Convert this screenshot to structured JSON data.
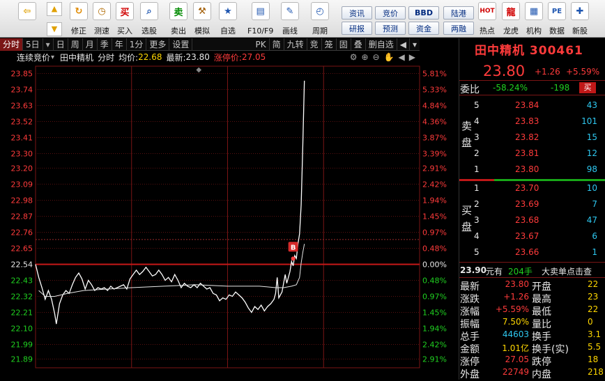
{
  "toolbar": {
    "items": [
      {
        "label": "",
        "icon": "back-arrow-icon"
      },
      {
        "label": "修正",
        "icon": "refresh-icon"
      },
      {
        "label": "测速",
        "icon": "stopwatch-icon"
      },
      {
        "label": "买入",
        "icon": "buy-icon",
        "glyph": "买"
      },
      {
        "label": "选股",
        "icon": "stock-picker-icon"
      },
      {
        "label": "卖出",
        "icon": "sell-icon",
        "glyph": "卖"
      },
      {
        "label": "模拟",
        "icon": "hammer-icon"
      },
      {
        "label": "自选",
        "icon": "watchlist-icon"
      },
      {
        "label": "F10/F9",
        "icon": "f10-icon"
      },
      {
        "label": "画线",
        "icon": "draw-line-icon"
      },
      {
        "label": "周期",
        "icon": "period-icon"
      },
      {
        "label": "热点",
        "icon": "hotspot-icon"
      },
      {
        "label": "龙虎",
        "icon": "dragon-tiger-icon"
      },
      {
        "label": "机构",
        "icon": "institution-icon"
      },
      {
        "label": "数据",
        "icon": "data-icon",
        "glyph": "PE"
      },
      {
        "label": "新股",
        "icon": "new-stock-icon"
      }
    ],
    "small_buttons": [
      "资讯",
      "研报",
      "竞价",
      "预测",
      "BBD",
      "资金",
      "陆港",
      "两融"
    ]
  },
  "tabs": [
    "分时",
    "5日",
    "日",
    "周",
    "月",
    "季",
    "年",
    "1分",
    "更多",
    "设置"
  ],
  "tabs_right": [
    "PK",
    "简",
    "九转",
    "竞",
    "笼",
    "固",
    "叠",
    "删自选"
  ],
  "infobar": {
    "mode": "连续竞价",
    "stock": "田中精机",
    "view": "分时",
    "avg_label": "均价:",
    "avg_value": "22.68",
    "latest_label": "最新:",
    "latest_value": "23.80",
    "limit_label": "涨停价:",
    "limit_value": "27.05"
  },
  "chart_data": {
    "type": "line",
    "prev_close": 22.54,
    "ylim": [
      21.83,
      23.9
    ],
    "yticks": [
      "23.85",
      "23.74",
      "23.63",
      "23.52",
      "23.41",
      "23.30",
      "23.20",
      "23.09",
      "22.98",
      "22.87",
      "22.76",
      "22.65",
      "22.54",
      "22.43",
      "22.32",
      "22.21",
      "22.10",
      "21.99",
      "21.89"
    ],
    "pct_ticks": [
      "5.81%",
      "5.33%",
      "4.84%",
      "4.36%",
      "3.87%",
      "3.39%",
      "2.91%",
      "2.42%",
      "1.94%",
      "1.45%",
      "0.97%",
      "0.48%",
      "0.00%",
      "0.48%",
      "0.97%",
      "1.45%",
      "1.94%",
      "2.42%",
      "2.91%"
    ],
    "xlim": [
      0,
      240
    ],
    "series": [
      {
        "name": "price",
        "color": "#ffffff",
        "points": [
          [
            0,
            22.54
          ],
          [
            2,
            22.45
          ],
          [
            4,
            22.38
          ],
          [
            6,
            22.3
          ],
          [
            8,
            22.36
          ],
          [
            10,
            22.3
          ],
          [
            12,
            22.2
          ],
          [
            13,
            22.13
          ],
          [
            15,
            22.27
          ],
          [
            17,
            22.33
          ],
          [
            19,
            22.36
          ],
          [
            21,
            22.34
          ],
          [
            23,
            22.4
          ],
          [
            25,
            22.45
          ],
          [
            27,
            22.48
          ],
          [
            29,
            22.44
          ],
          [
            31,
            22.37
          ],
          [
            33,
            22.43
          ],
          [
            35,
            22.4
          ],
          [
            37,
            22.36
          ],
          [
            39,
            22.38
          ],
          [
            41,
            22.37
          ],
          [
            43,
            22.38
          ],
          [
            45,
            22.36
          ],
          [
            47,
            22.39
          ],
          [
            49,
            22.37
          ],
          [
            51,
            22.38
          ],
          [
            53,
            22.39
          ],
          [
            55,
            22.4
          ],
          [
            57,
            22.37
          ],
          [
            59,
            22.44
          ],
          [
            61,
            22.47
          ],
          [
            63,
            22.5
          ],
          [
            65,
            22.47
          ],
          [
            67,
            22.49
          ],
          [
            69,
            22.52
          ],
          [
            71,
            22.49
          ],
          [
            73,
            22.46
          ],
          [
            75,
            22.47
          ],
          [
            77,
            22.5
          ],
          [
            79,
            22.47
          ],
          [
            81,
            22.43
          ],
          [
            83,
            22.45
          ],
          [
            85,
            22.42
          ],
          [
            87,
            22.47
          ],
          [
            89,
            22.43
          ],
          [
            91,
            22.38
          ],
          [
            93,
            22.41
          ],
          [
            95,
            22.39
          ],
          [
            97,
            22.38
          ],
          [
            99,
            22.4
          ],
          [
            101,
            22.38
          ],
          [
            103,
            22.41
          ],
          [
            105,
            22.39
          ],
          [
            107,
            22.37
          ],
          [
            109,
            22.38
          ],
          [
            111,
            22.34
          ],
          [
            113,
            22.33
          ],
          [
            115,
            22.29
          ],
          [
            117,
            22.31
          ],
          [
            119,
            22.3
          ],
          [
            121,
            22.33
          ],
          [
            123,
            22.32
          ],
          [
            125,
            22.35
          ],
          [
            127,
            22.33
          ],
          [
            129,
            22.31
          ],
          [
            131,
            22.28
          ],
          [
            133,
            22.24
          ],
          [
            135,
            22.21
          ],
          [
            137,
            22.25
          ],
          [
            139,
            22.23
          ],
          [
            141,
            22.26
          ],
          [
            143,
            22.22
          ],
          [
            145,
            22.25
          ],
          [
            147,
            22.27
          ],
          [
            149,
            22.3
          ],
          [
            150,
            22.34
          ],
          [
            151,
            22.45
          ],
          [
            152,
            22.31
          ],
          [
            154,
            22.35
          ],
          [
            156,
            22.47
          ],
          [
            157,
            22.41
          ],
          [
            159,
            22.49
          ],
          [
            160,
            22.56
          ],
          [
            161,
            22.53
          ],
          [
            162,
            22.6
          ],
          [
            163,
            22.58
          ],
          [
            164,
            22.68
          ],
          [
            165,
            22.75
          ],
          [
            166,
            22.95
          ],
          [
            167,
            23.35
          ],
          [
            168,
            23.8
          ]
        ]
      },
      {
        "name": "avg",
        "color": "#e8e8e8",
        "points": [
          [
            2,
            22.36
          ],
          [
            6,
            22.32
          ],
          [
            12,
            22.32
          ],
          [
            20,
            22.34
          ],
          [
            30,
            22.36
          ],
          [
            45,
            22.37
          ],
          [
            60,
            22.38
          ],
          [
            80,
            22.39
          ],
          [
            100,
            22.4
          ],
          [
            120,
            22.39
          ],
          [
            140,
            22.39
          ],
          [
            150,
            22.38
          ],
          [
            155,
            22.38
          ],
          [
            160,
            22.39
          ],
          [
            163,
            22.4
          ],
          [
            165,
            22.45
          ],
          [
            166,
            22.55
          ],
          [
            167,
            22.62
          ],
          [
            168,
            22.68
          ]
        ]
      }
    ],
    "marker": {
      "label": "B",
      "x": 161,
      "y": 22.56
    }
  },
  "right_panel": {
    "title": "田中精机 300461",
    "price": "23.80",
    "change": "+1.26",
    "change_pct": "+5.59%",
    "committee_label": "委比",
    "committee_pct": "-58.24%",
    "committee_diff": "-198",
    "buy_btn": "买",
    "sell_label": "卖盘",
    "buy_label": "买盘",
    "sell_rows": [
      {
        "lvl": "5",
        "price": "23.84",
        "vol": "43"
      },
      {
        "lvl": "4",
        "price": "23.83",
        "vol": "101"
      },
      {
        "lvl": "3",
        "price": "23.82",
        "vol": "15"
      },
      {
        "lvl": "2",
        "price": "23.81",
        "vol": "12"
      },
      {
        "lvl": "1",
        "price": "23.80",
        "vol": "98"
      }
    ],
    "buy_rows": [
      {
        "lvl": "1",
        "price": "23.70",
        "vol": "10"
      },
      {
        "lvl": "2",
        "price": "23.69",
        "vol": "7"
      },
      {
        "lvl": "3",
        "price": "23.68",
        "vol": "47"
      },
      {
        "lvl": "4",
        "price": "23.67",
        "vol": "6"
      },
      {
        "lvl": "5",
        "price": "23.66",
        "vol": "1"
      }
    ],
    "bigorder": {
      "price": "23.90",
      "unit": "元有",
      "qty": "204手",
      "text": "大卖单点击查"
    },
    "stats": [
      {
        "l": "最新",
        "v": "23.80",
        "l2": "开盘",
        "v2": "22"
      },
      {
        "l": "涨跌",
        "v": "+1.26",
        "l2": "最高",
        "v2": "23"
      },
      {
        "l": "涨幅",
        "v": "+5.59%",
        "l2": "最低",
        "v2": "22"
      },
      {
        "l": "振幅",
        "v": "7.50%",
        "l2": "量比",
        "v2": "0"
      },
      {
        "l": "总手",
        "v": "44603",
        "l2": "换手",
        "v2": "3.1"
      },
      {
        "l": "金额",
        "v": "1.01亿",
        "l2": "换手(实)",
        "v2": "5.5"
      },
      {
        "l": "涨停",
        "v": "27.05",
        "l2": "跌停",
        "v2": "18"
      },
      {
        "l": "外盘",
        "v": "22749",
        "l2": "内盘",
        "v2": "218"
      }
    ]
  }
}
